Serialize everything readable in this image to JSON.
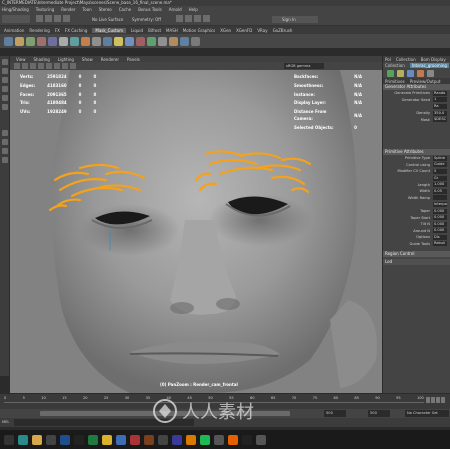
{
  "window": {
    "title": "C_INTERMEDIATE\\Intermediate Project\\Maya\\scenes\\Scene_base_16_final_scene.ma*"
  },
  "main_menu": [
    "Hing/Shading",
    "Texturing",
    "Render",
    "Toon",
    "Stereo",
    "Cache",
    "Bonus Tools",
    "Arnold",
    "Help"
  ],
  "status_line": {
    "no_live_surface": "No Live Surface",
    "symmetry": "Symmetry: Off",
    "sign_in": "Sign In"
  },
  "shelf_tabs": [
    "Animation",
    "Rendering",
    "FX",
    "FX Caching",
    "Mask_Custom",
    "Liquid",
    "Bifrost",
    "MASH",
    "Motion Graphics",
    "XGen",
    "XGenFD",
    "VRay",
    "GoZBrush"
  ],
  "shelf_active_tab": "Mask_Custom",
  "viewport": {
    "menu": [
      "View",
      "Shading",
      "Lighting",
      "Show",
      "Renderer",
      "Panels"
    ],
    "color_space": "sRGB gamma",
    "hud_left": [
      {
        "label": "Verts:",
        "c1": "2591824",
        "c2": "0",
        "c3": "0"
      },
      {
        "label": "Edges:",
        "c1": "4183160",
        "c2": "0",
        "c3": "0"
      },
      {
        "label": "Faces:",
        "c1": "2091365",
        "c2": "0",
        "c3": "0"
      },
      {
        "label": "Tris:",
        "c1": "4180484",
        "c2": "0",
        "c3": "0"
      },
      {
        "label": "UVs:",
        "c1": "1928249",
        "c2": "0",
        "c3": "0"
      }
    ],
    "hud_right": [
      {
        "label": "Backfaces:",
        "value": "N/A"
      },
      {
        "label": "Smoothness:",
        "value": "N/A"
      },
      {
        "label": "Instance:",
        "value": "N/A"
      },
      {
        "label": "Display Layer:",
        "value": "N/A"
      },
      {
        "label": "Distance From Camera:",
        "value": "N/A"
      },
      {
        "label": "Selected Objects:",
        "value": "0"
      }
    ],
    "caption": "(0) PanZoom : Render_cam_frontal"
  },
  "attribute_editor": {
    "top_tabs": [
      "Pol",
      "Collection",
      "Bom Display"
    ],
    "node_tabs": [
      "Collection",
      "Interac_grooming"
    ],
    "sub_tabs": [
      "Primitives",
      "Preview/Output"
    ],
    "sections": {
      "generator": "Generator Attributes",
      "primitive": "Primitive Attributes",
      "region": "Region Control",
      "lod": "Lod"
    },
    "generator_attrs": [
      {
        "label": "Generate Primitives",
        "value": "Rando"
      },
      {
        "label": "Generator Seed",
        "value": "1"
      },
      {
        "label": "",
        "value": "Ra"
      },
      {
        "label": "Density",
        "value": "350.0"
      },
      {
        "label": "Mask",
        "value": "$DESC"
      }
    ],
    "primitive_attrs": [
      {
        "label": "Primitive Type",
        "value": "Spline"
      },
      {
        "label": "Control using",
        "value": "Guide"
      },
      {
        "label": "Modifier CV Count",
        "value": "5"
      },
      {
        "label": "",
        "value": "Gr"
      },
      {
        "label": "Length",
        "value": "1.000"
      },
      {
        "label": "Width",
        "value": "0.05"
      },
      {
        "label": "Width Ramp",
        "value": ""
      },
      {
        "label": "",
        "value": "Interpo"
      },
      {
        "label": "Taper",
        "value": "0.000"
      },
      {
        "label": "Taper Start",
        "value": "0.000"
      },
      {
        "label": "Tilt N",
        "value": "0.000"
      },
      {
        "label": "Around N",
        "value": "0.000"
      },
      {
        "label": "Options",
        "value": "Dis"
      },
      {
        "label": "Guide Tools",
        "value": "Rebuil"
      }
    ]
  },
  "timeline": {
    "ticks": [
      "0",
      "5",
      "10",
      "15",
      "20",
      "25",
      "30",
      "35",
      "40",
      "45",
      "50",
      "55",
      "60",
      "65",
      "70",
      "75",
      "80",
      "85",
      "90",
      "95",
      "100"
    ],
    "range_values": [
      "500",
      "500"
    ],
    "character_set": "No Character Set"
  },
  "taskbar_icons": [
    "search",
    "maya",
    "folder",
    "zbrush",
    "photoshop",
    "k",
    "x",
    "chrome",
    "vray",
    "marvelous",
    "substance",
    "mari",
    "headus",
    "nuke",
    "spotify",
    "arnold",
    "firefox",
    "unreal",
    "other"
  ],
  "watermark_text": "人人素材",
  "colors": {
    "curve": "#f4a21b",
    "accent": "#5285a6",
    "viewport_bg": "#7f7f7f"
  }
}
